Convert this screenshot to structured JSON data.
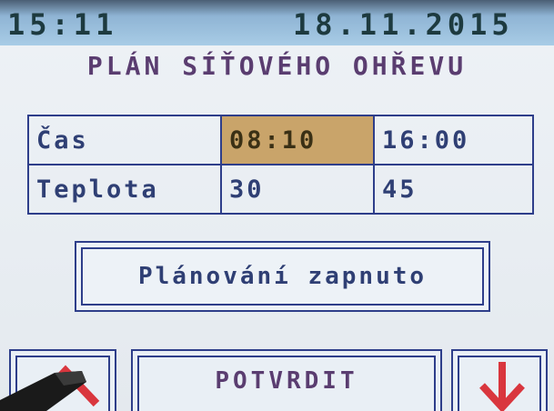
{
  "status": {
    "time": "15:11",
    "date": "18.11.2015"
  },
  "title": "PLÁN SÍŤOVÉHO OHŘEVU",
  "schedule": {
    "rows": [
      {
        "label": "Čas",
        "values": [
          "08:10",
          "16:00"
        ]
      },
      {
        "label": "Teplota",
        "values": [
          "30",
          "45"
        ]
      }
    ]
  },
  "plan_toggle": {
    "label": "Plánování zapnuto"
  },
  "buttons": {
    "up_icon": "up-arrow-icon",
    "confirm_label": "POTVRDIT",
    "down_icon": "down-arrow-icon"
  },
  "colors": {
    "text": "#2f3f74",
    "title": "#5a3d70",
    "border": "#2e3e8a",
    "selected_cell": "#c9a46a",
    "down_arrow": "#d9363e",
    "status_bar": "#a8cce6"
  }
}
